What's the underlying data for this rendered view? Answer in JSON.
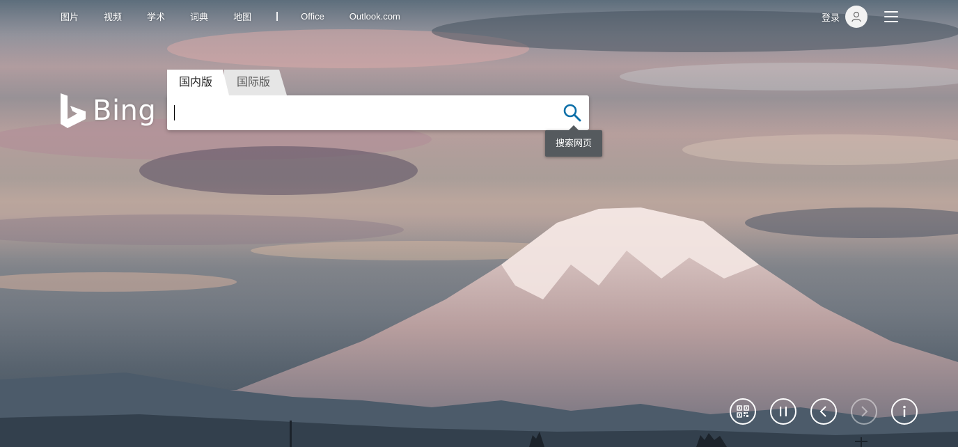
{
  "nav": {
    "links": [
      "图片",
      "视频",
      "学术",
      "词典",
      "地图",
      "Office",
      "Outlook.com"
    ]
  },
  "account": {
    "login_label": "登录",
    "avatar_icon": "user-icon",
    "menu_icon": "hamburger-menu-icon"
  },
  "logo": {
    "text": "Bing",
    "icon": "bing-b-icon"
  },
  "search": {
    "tabs": [
      {
        "label": "国内版",
        "active": true
      },
      {
        "label": "国际版",
        "active": false
      }
    ],
    "value": "",
    "button_icon": "search-icon",
    "tooltip": "搜索网页"
  },
  "controls": [
    {
      "icon": "qr-code-icon",
      "enabled": true
    },
    {
      "icon": "pause-icon",
      "enabled": true
    },
    {
      "icon": "chevron-left-icon",
      "enabled": true
    },
    {
      "icon": "chevron-right-icon",
      "enabled": false
    },
    {
      "icon": "info-icon",
      "enabled": true
    }
  ],
  "colors": {
    "accent": "#0c6fa8",
    "text_on_image": "#ffffff"
  }
}
